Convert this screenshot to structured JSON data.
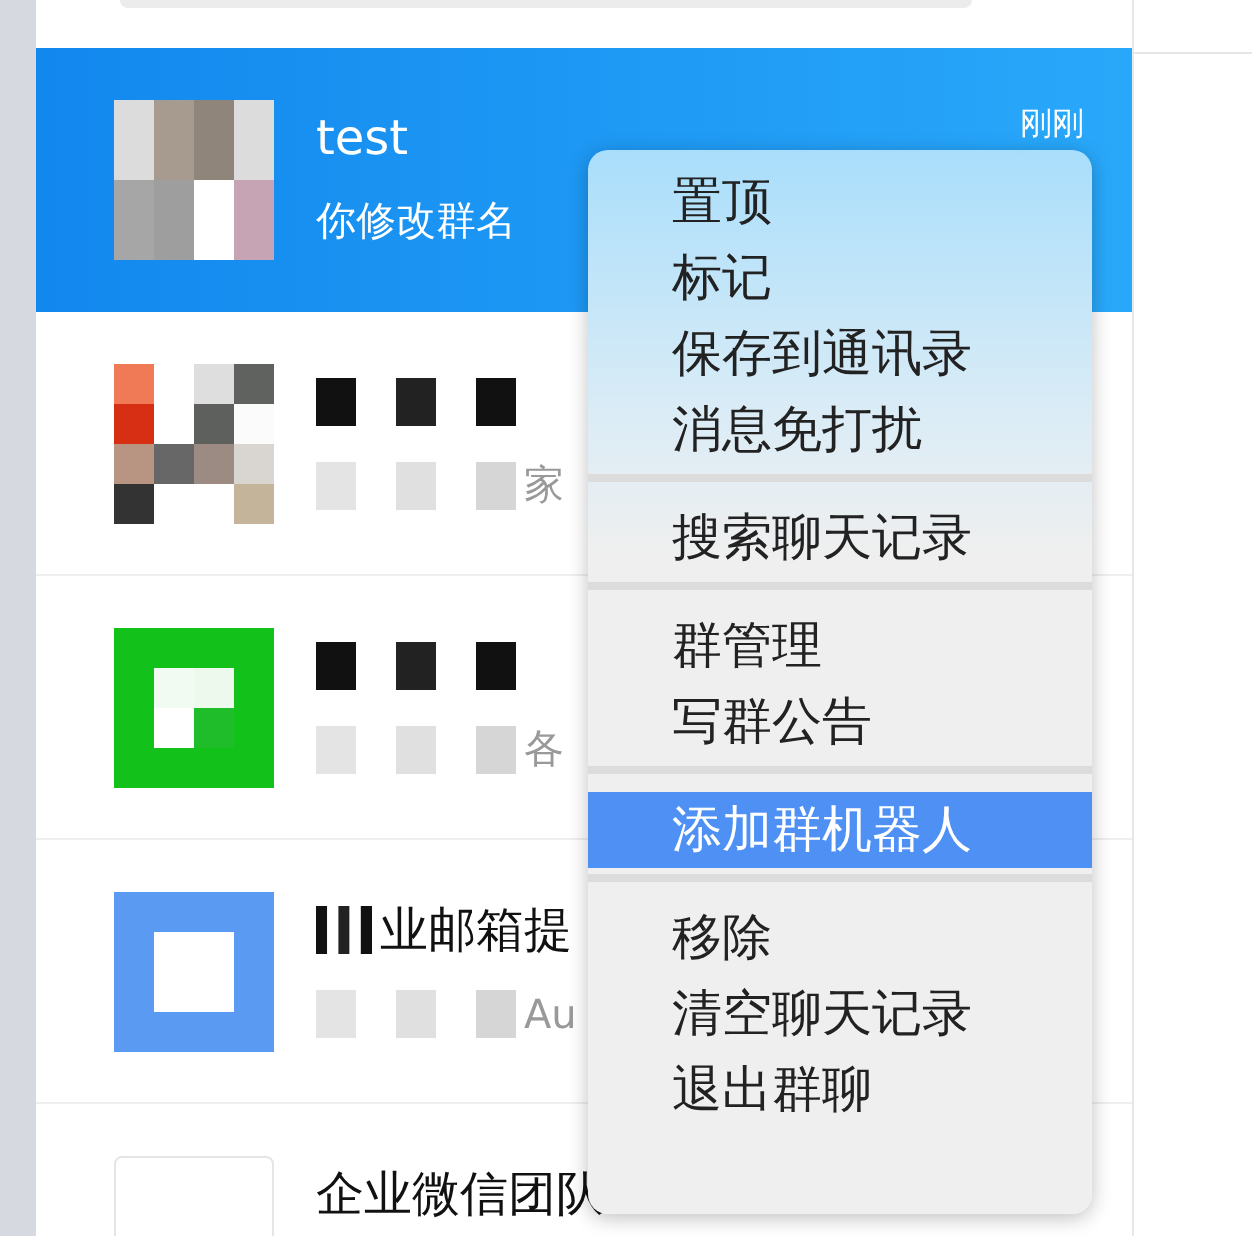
{
  "chats": [
    {
      "title": "test",
      "preview": "你修改群名",
      "time": "刚刚",
      "selected": true,
      "redacted": false
    },
    {
      "preview": "家",
      "selected": false,
      "redacted": true
    },
    {
      "preview": "各",
      "selected": false,
      "redacted": true
    },
    {
      "title": "业邮箱提",
      "preview": "Au",
      "selected": false,
      "redacted": true
    },
    {
      "title": "企业微信团队",
      "selected": false,
      "redacted": false
    }
  ],
  "context_menu": {
    "groups": [
      [
        {
          "label": "置顶",
          "selected": false
        },
        {
          "label": "标记",
          "selected": false
        },
        {
          "label": "保存到通讯录",
          "selected": false
        },
        {
          "label": "消息免打扰",
          "selected": false
        }
      ],
      [
        {
          "label": "搜索聊天记录",
          "selected": false
        }
      ],
      [
        {
          "label": "群管理",
          "selected": false
        },
        {
          "label": "写群公告",
          "selected": false
        }
      ],
      [
        {
          "label": "添加群机器人",
          "selected": true
        }
      ],
      [
        {
          "label": "移除",
          "selected": false
        },
        {
          "label": "清空聊天记录",
          "selected": false
        },
        {
          "label": "退出群聊",
          "selected": false
        }
      ]
    ]
  }
}
